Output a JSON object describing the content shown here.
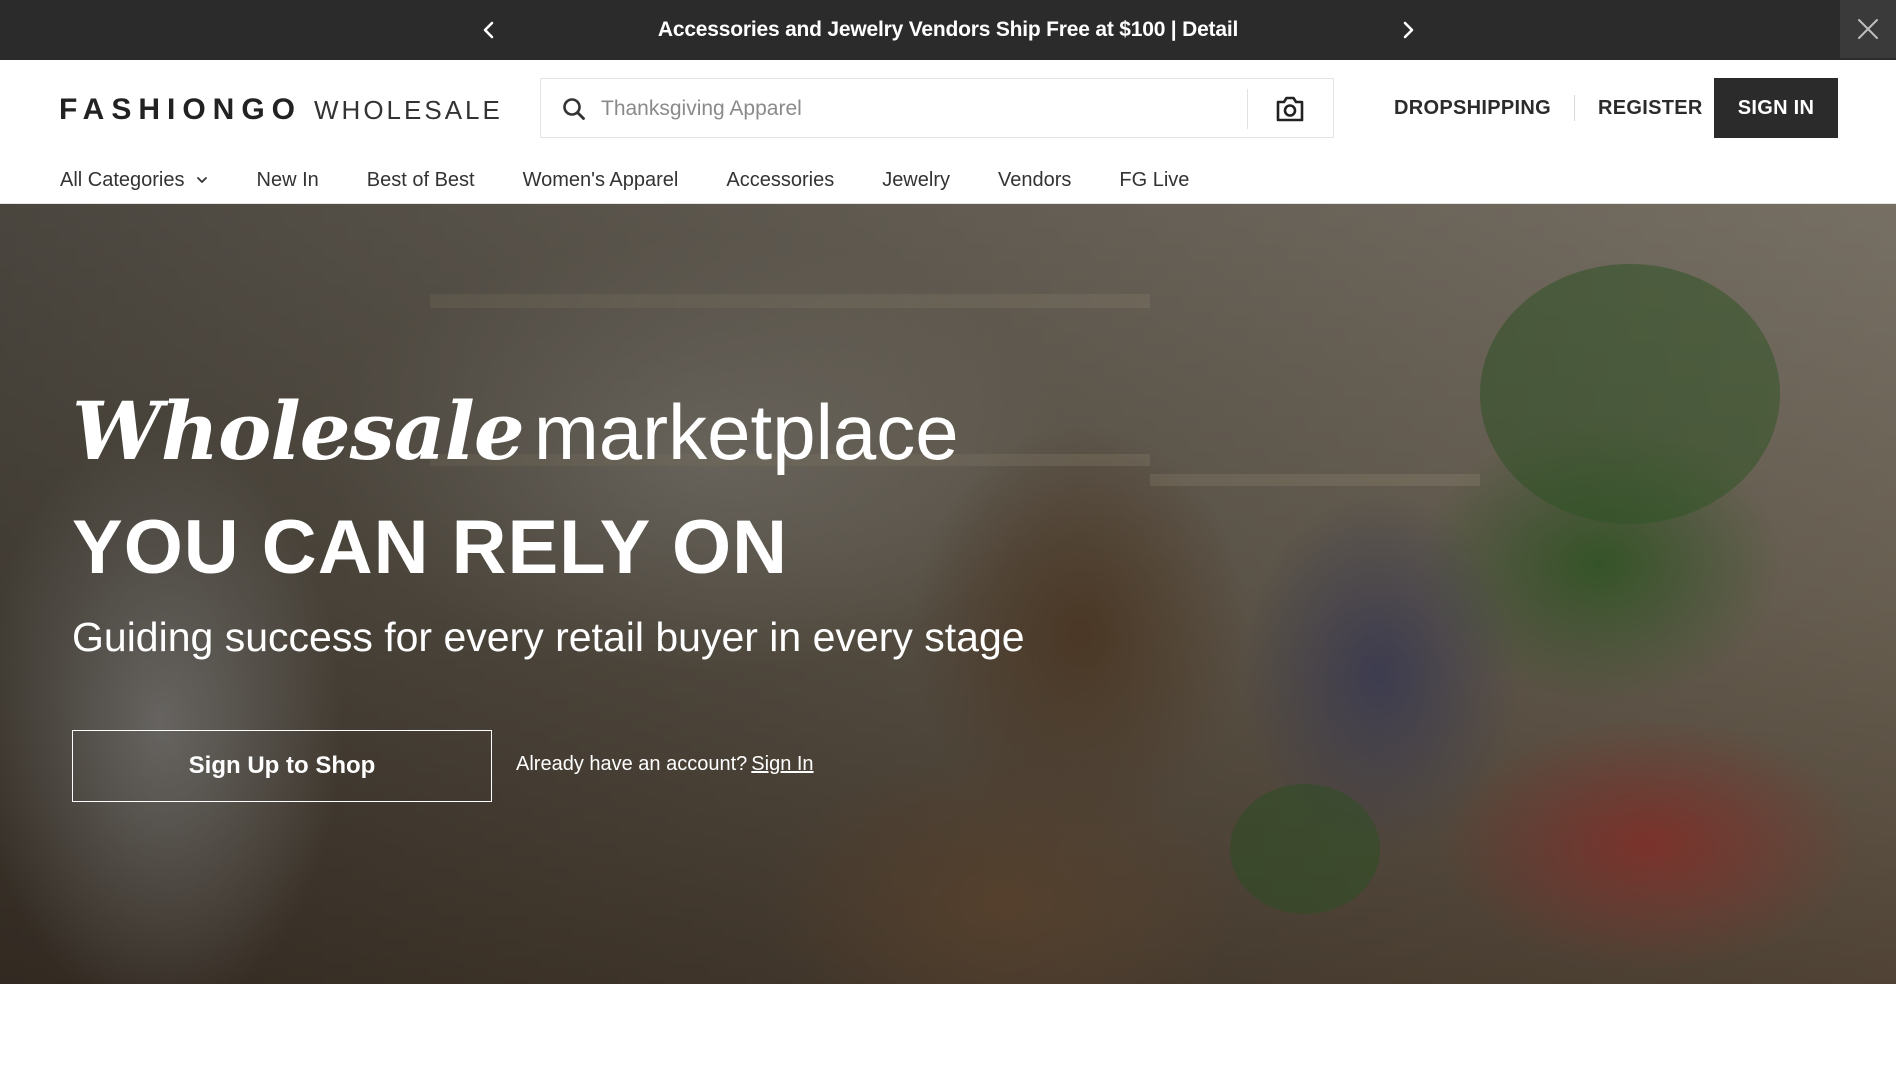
{
  "announcement": {
    "message": "Accessories and Jewelry Vendors Ship Free at $100 | Detail",
    "prev_icon": "chevron-left-icon",
    "next_icon": "chevron-right-icon",
    "close_icon": "close-icon"
  },
  "header": {
    "logo_brand": "FASHIONGO",
    "logo_sub": "WHOLESALE",
    "search": {
      "placeholder": "Thanksgiving Apparel",
      "value": "",
      "icon": "search-icon",
      "camera_icon": "camera-icon"
    },
    "links": {
      "dropshipping": "DROPSHIPPING",
      "register": "REGISTER",
      "signin": "SIGN IN"
    },
    "nav": [
      {
        "label": "All Categories",
        "has_dropdown": true
      },
      {
        "label": "New In"
      },
      {
        "label": "Best of Best"
      },
      {
        "label": "Women's Apparel"
      },
      {
        "label": "Accessories"
      },
      {
        "label": "Jewelry"
      },
      {
        "label": "Vendors"
      },
      {
        "label": "FG Live"
      }
    ]
  },
  "hero": {
    "headline_italic": "Wholesale",
    "headline_rest": "marketplace",
    "headline_bold": "YOU CAN RELY ON",
    "subheadline": "Guiding success for every retail buyer in every stage",
    "cta_label": "Sign Up to Shop",
    "already_text": "Already have an account?",
    "signin_link": "Sign In"
  },
  "colors": {
    "top_bar": "#2b2b2b",
    "signin_button": "#2b2b2b",
    "text_dark": "#222222",
    "hero_text": "#ffffff"
  }
}
